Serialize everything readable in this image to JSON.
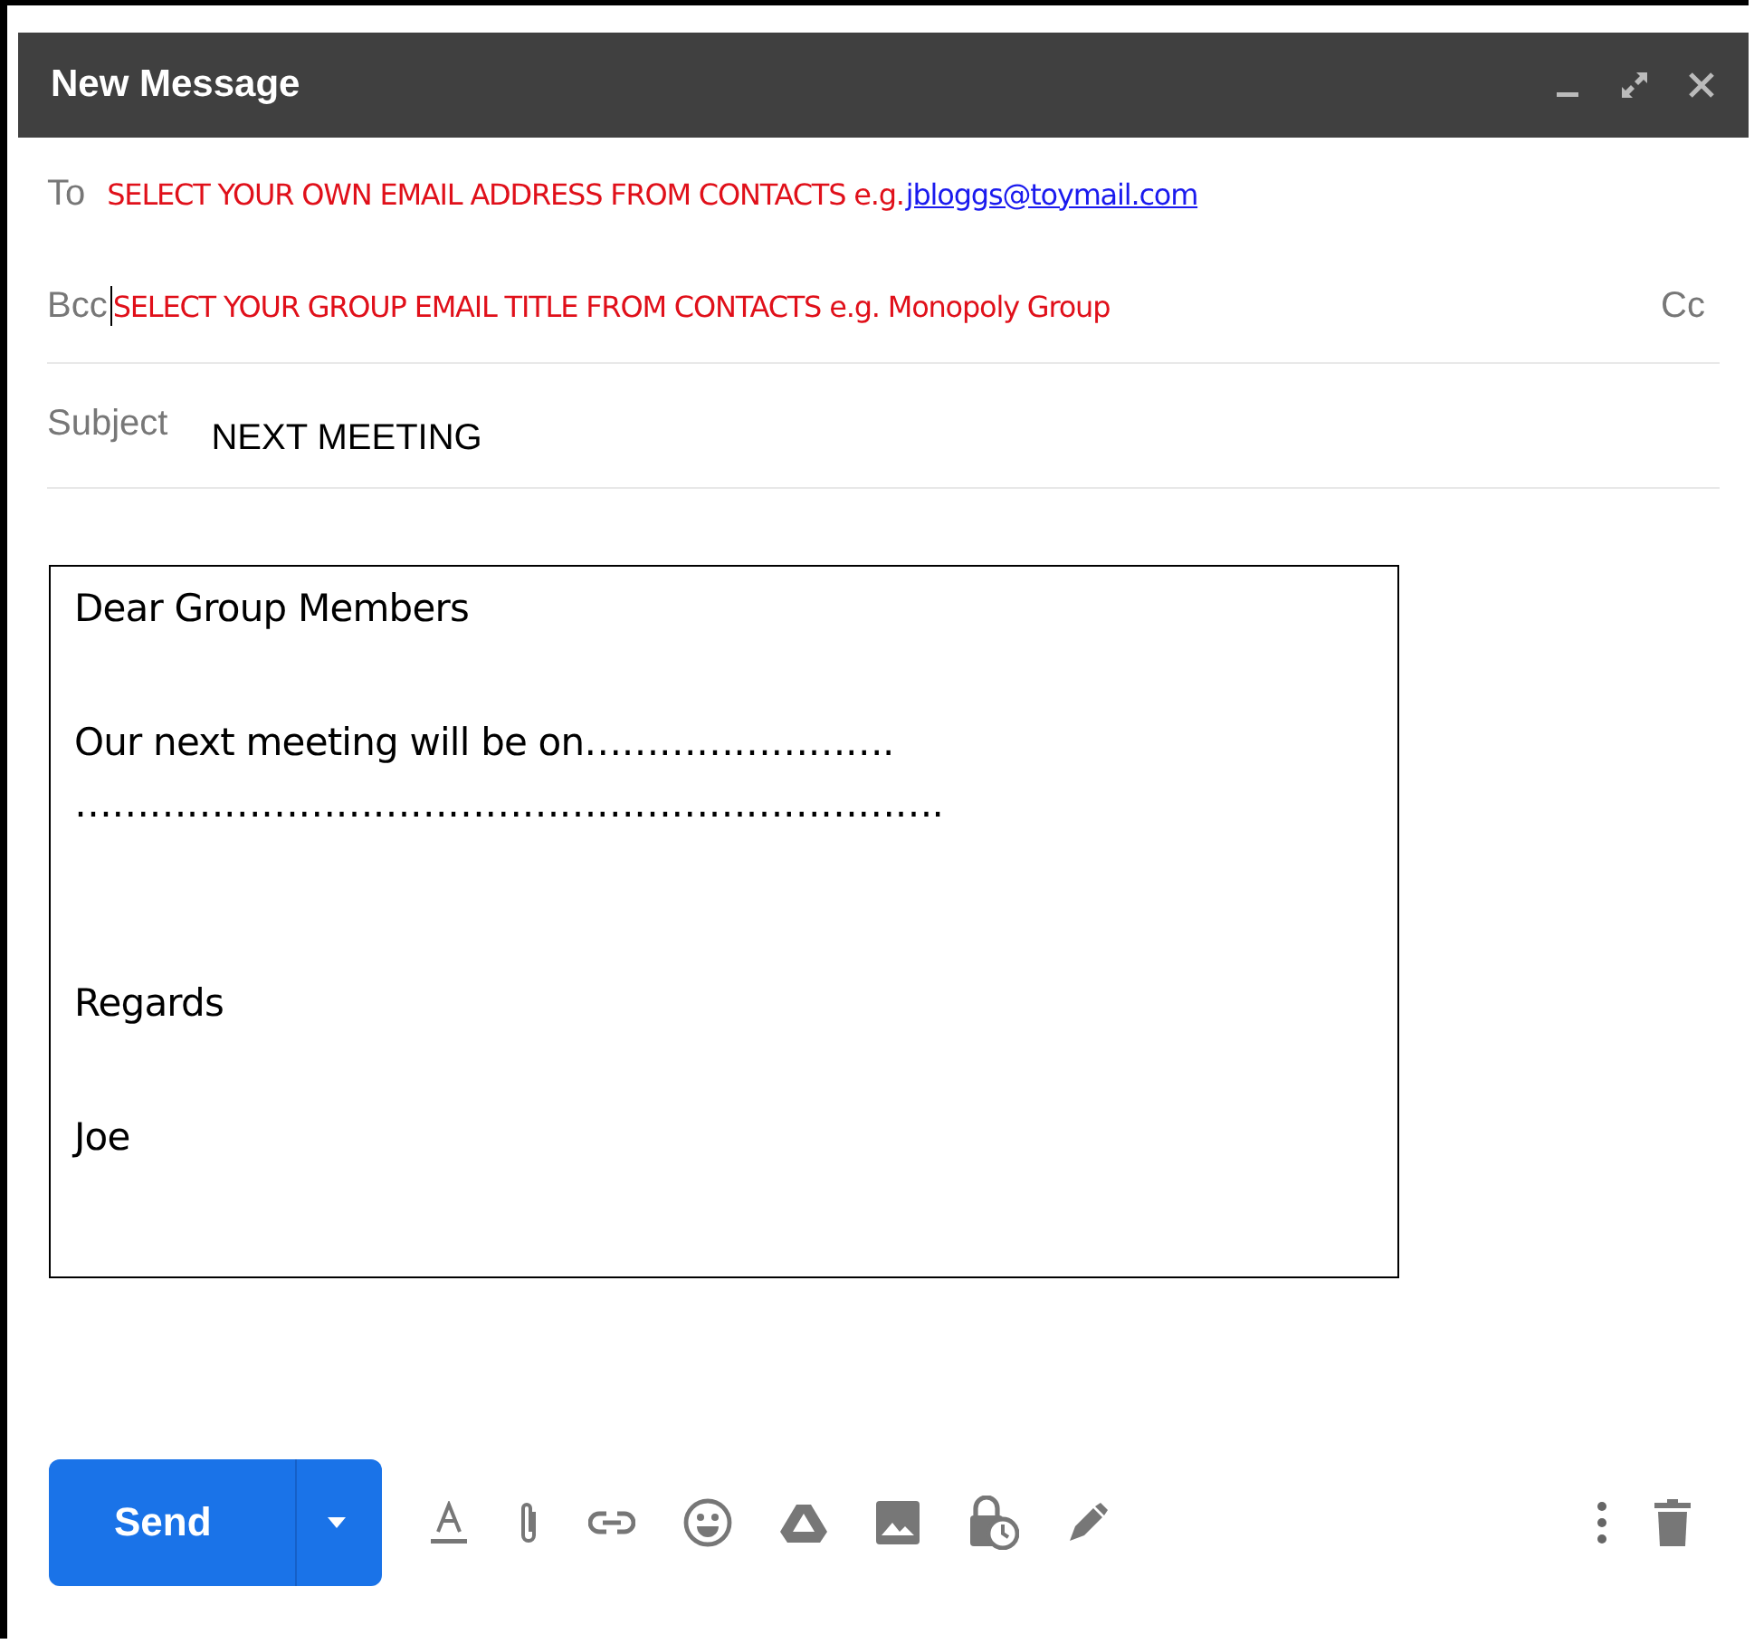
{
  "window": {
    "title": "New Message"
  },
  "to": {
    "label": "To",
    "hint": "SELECT YOUR OWN EMAIL ADDRESS FROM CONTACTS e.g.",
    "link": "jbloggs@toymail.com"
  },
  "bcc": {
    "label": "Bcc",
    "hint": "SELECT YOUR GROUP EMAIL TITLE FROM CONTACTS e.g. Monopoly Group",
    "cc": "Cc"
  },
  "subject": {
    "label": "Subject",
    "value": "NEXT MEETING"
  },
  "body": {
    "paragraphs": [
      [
        "Dear Group Members"
      ],
      [
        "Our next meeting will be on…………………….",
        "……………………………………………………………."
      ],
      [
        "Regards"
      ],
      [
        "Joe"
      ]
    ]
  },
  "send_button": "Send"
}
